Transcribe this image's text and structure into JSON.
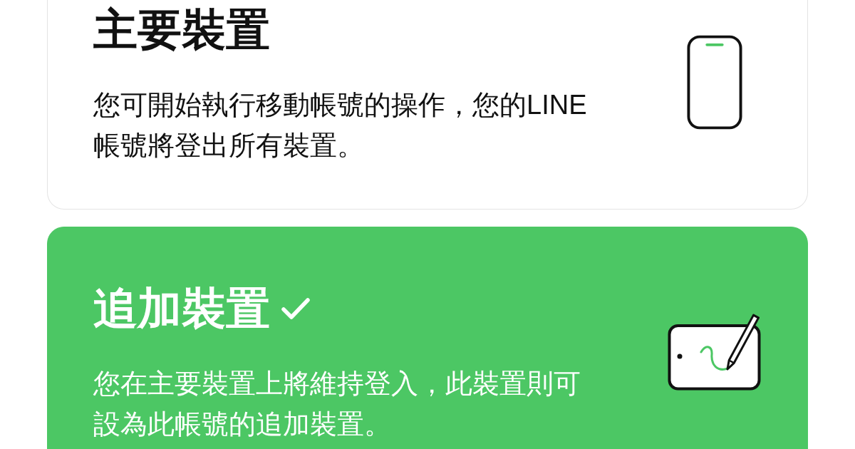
{
  "options": [
    {
      "kind": "phone",
      "title": "主要裝置",
      "description": "您可開始執行移動帳號的操作，您的LINE帳號將登出所有裝置。",
      "selected": false
    },
    {
      "kind": "tablet",
      "title": "追加裝置",
      "description": "您在主要裝置上將維持登入，此裝置則可設為此帳號的追加裝置。",
      "selected": true
    }
  ]
}
